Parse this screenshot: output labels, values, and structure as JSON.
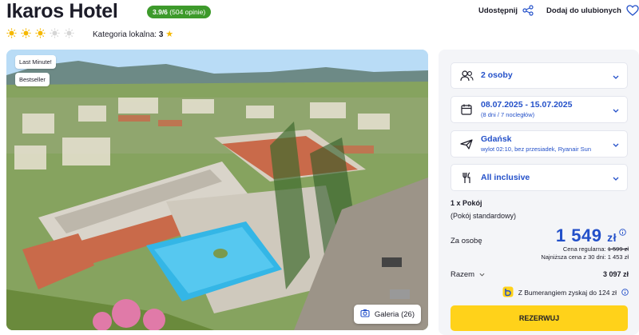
{
  "hotel": {
    "name": "Ikaros Hotel",
    "rating_score": "3.9/6",
    "rating_count": "(504 opinie)",
    "sun_rating": 3,
    "sun_rating_max": 5,
    "category_label": "Kategoria lokalna:",
    "category_value": "3"
  },
  "header_actions": {
    "share_label": "Udostępnij",
    "favorite_label": "Dodaj do ulubionych"
  },
  "photo": {
    "badges": [
      "Last Minute!",
      "Bestseller"
    ],
    "gallery_label": "Galeria (26)"
  },
  "booking": {
    "guests": "2 osoby",
    "dates": "08.07.2025 - 15.07.2025",
    "dates_detail": "(8 dni / 7 nocległów)",
    "departure_city": "Gdańsk",
    "departure_detail": "wylot 02:10, bez przesiadek, Ryanair Sun",
    "board": "All inclusive",
    "room_count": "1 x Pokój",
    "room_type": "(Pokój standardowy)",
    "per_person_label": "Za osobę",
    "price": "1 549",
    "price_currency": "zł",
    "regular_label": "Cena regularna:",
    "regular_price": "1 599 zł",
    "lowest_label": "Najniższa cena z 30 dni: 1 453 zł",
    "total_label": "Razem",
    "total_value": "3 097 zł",
    "bumerang_text": "Z Bumerangiem zyskaj do 124 zł",
    "book_label": "REZERWUJ"
  },
  "colors": {
    "accent_blue": "#2350c9",
    "rating_green": "#3d9a2b",
    "cta_yellow": "#ffd21a",
    "sun_active": "#f5b800",
    "sun_inactive": "#d6d6d6"
  }
}
